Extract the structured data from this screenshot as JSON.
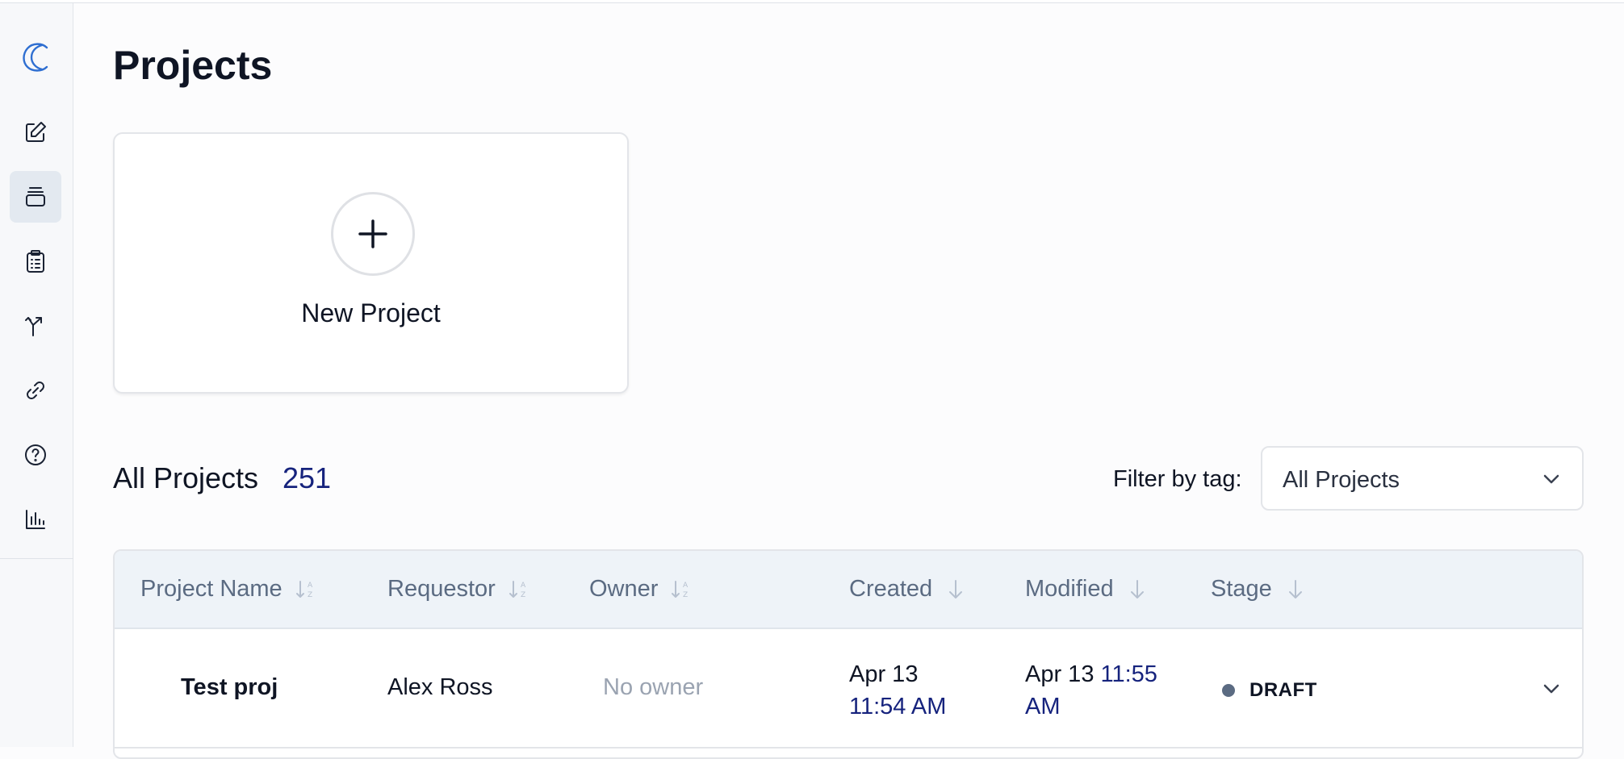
{
  "page": {
    "title": "Projects"
  },
  "new_project": {
    "label": "New Project"
  },
  "projects_header": {
    "label": "All Projects",
    "count": "251"
  },
  "filter": {
    "label": "Filter by tag:",
    "selected": "All Projects"
  },
  "table": {
    "columns": [
      {
        "label": "Project Name",
        "sort": "alpha"
      },
      {
        "label": "Requestor",
        "sort": "alpha"
      },
      {
        "label": "Owner",
        "sort": "alpha"
      },
      {
        "label": "Created",
        "sort": "desc"
      },
      {
        "label": "Modified",
        "sort": "desc"
      },
      {
        "label": "Stage",
        "sort": "desc"
      }
    ],
    "rows": [
      {
        "name": "Test proj",
        "requestor": "Alex Ross",
        "owner": "No owner",
        "created_date": "Apr 13",
        "created_time": "11:54 AM",
        "modified_date": "Apr 13",
        "modified_time_1": "11:55",
        "modified_time_2": "AM",
        "stage": "DRAFT"
      }
    ]
  },
  "colors": {
    "accent": "#16237d",
    "logo": "#2f6fd1",
    "active_nav_bg": "#e3e9f0",
    "header_bg": "#eef3f8"
  },
  "sidebar": {
    "icons": [
      "logo-icon",
      "edit-icon",
      "stack-icon",
      "clipboard-icon",
      "branch-icon",
      "link-icon",
      "help-icon",
      "chart-icon"
    ]
  }
}
